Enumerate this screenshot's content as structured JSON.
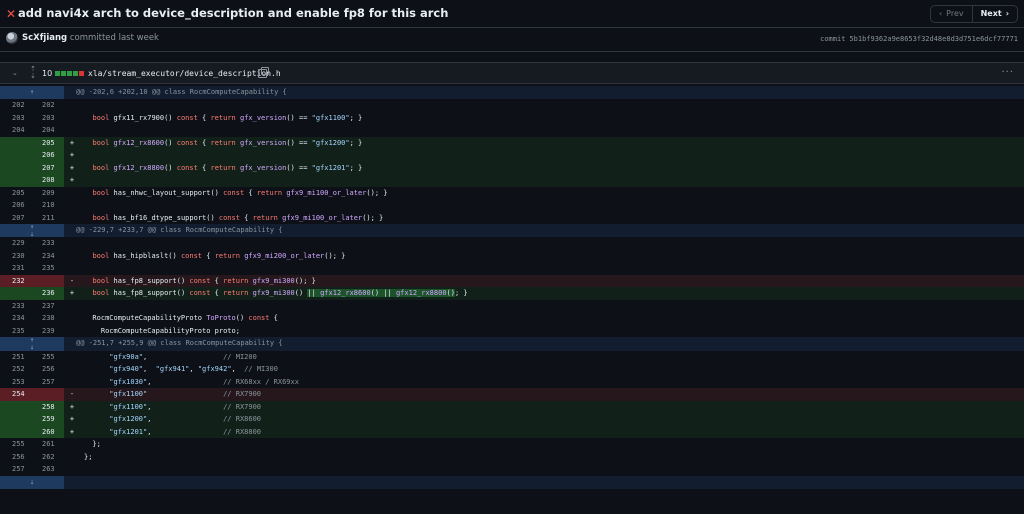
{
  "commit": {
    "title": "add navi4x arch to device_description and enable fp8 for this arch",
    "author": "ScXfjiang",
    "committed_text": "committed last week",
    "sha_label": "commit",
    "sha": "5b1bf9362a9e8653f32d48e8d3d751e6dcf77771",
    "prev_label": "Prev",
    "next_label": "Next"
  },
  "file": {
    "change_count": "10",
    "path": "xla/stream_executor/device_description.h",
    "diffstat_colors": [
      "#2ea043",
      "#2ea043",
      "#2ea043",
      "#2ea043",
      "#da3633"
    ]
  },
  "hunks": [
    {
      "header": "@@ -202,6 +202,10 @@ class RocmComputeCapability {"
    },
    {
      "header": "@@ -229,7 +233,7 @@ class RocmComputeCapability {"
    },
    {
      "header": "@@ -251,7 +255,9 @@ class RocmComputeCapability {"
    }
  ],
  "lines": [
    {
      "type": "ctx",
      "old": "202",
      "new": "202",
      "sign": "",
      "code": ""
    },
    {
      "type": "ctx",
      "old": "203",
      "new": "203",
      "sign": "",
      "code": "  bool gfx11_rx7900() const { return gfx_version() == \"gfx1100\"; }"
    },
    {
      "type": "ctx",
      "old": "204",
      "new": "204",
      "sign": "",
      "code": ""
    },
    {
      "type": "add",
      "old": "",
      "new": "205",
      "sign": "+",
      "code": "  bool gfx12_rx8600() const { return gfx_version() == \"gfx1200\"; }"
    },
    {
      "type": "add",
      "old": "",
      "new": "206",
      "sign": "+",
      "code": ""
    },
    {
      "type": "add",
      "old": "",
      "new": "207",
      "sign": "+",
      "code": "  bool gfx12_rx8800() const { return gfx_version() == \"gfx1201\"; }"
    },
    {
      "type": "add",
      "old": "",
      "new": "208",
      "sign": "+",
      "code": ""
    },
    {
      "type": "ctx",
      "old": "205",
      "new": "209",
      "sign": "",
      "code": "  bool has_nhwc_layout_support() const { return gfx9_mi100_or_later(); }"
    },
    {
      "type": "ctx",
      "old": "206",
      "new": "210",
      "sign": "",
      "code": ""
    },
    {
      "type": "ctx",
      "old": "207",
      "new": "211",
      "sign": "",
      "code": "  bool has_bf16_dtype_support() const { return gfx9_mi100_or_later(); }"
    },
    {
      "type": "ctx",
      "old": "229",
      "new": "233",
      "sign": "",
      "code": ""
    },
    {
      "type": "ctx",
      "old": "230",
      "new": "234",
      "sign": "",
      "code": "  bool has_hipblaslt() const { return gfx9_mi200_or_later(); }"
    },
    {
      "type": "ctx",
      "old": "231",
      "new": "235",
      "sign": "",
      "code": ""
    },
    {
      "type": "del",
      "old": "232",
      "new": "",
      "sign": "-",
      "code": "  bool has_fp8_support() const { return gfx9_mi300(); }"
    },
    {
      "type": "add",
      "old": "",
      "new": "236",
      "sign": "+",
      "code": "  bool has_fp8_support() const { return gfx9_mi300() || gfx12_rx8600() || gfx12_rx8800(); }"
    },
    {
      "type": "ctx",
      "old": "233",
      "new": "237",
      "sign": "",
      "code": ""
    },
    {
      "type": "ctx",
      "old": "234",
      "new": "238",
      "sign": "",
      "code": "  RocmComputeCapabilityProto ToProto() const {"
    },
    {
      "type": "ctx",
      "old": "235",
      "new": "239",
      "sign": "",
      "code": "    RocmComputeCapabilityProto proto;"
    },
    {
      "type": "ctx",
      "old": "251",
      "new": "255",
      "sign": "",
      "code": "      \"gfx90a\",                  // MI200"
    },
    {
      "type": "ctx",
      "old": "252",
      "new": "256",
      "sign": "",
      "code": "      \"gfx940\",  \"gfx941\", \"gfx942\",  // MI300"
    },
    {
      "type": "ctx",
      "old": "253",
      "new": "257",
      "sign": "",
      "code": "      \"gfx1030\",                 // RX68xx / RX69xx"
    },
    {
      "type": "del",
      "old": "254",
      "new": "",
      "sign": "-",
      "code": "      \"gfx1100\"                  // RX7900"
    },
    {
      "type": "add",
      "old": "",
      "new": "258",
      "sign": "+",
      "code": "      \"gfx1100\",                 // RX7900"
    },
    {
      "type": "add",
      "old": "",
      "new": "259",
      "sign": "+",
      "code": "      \"gfx1200\",                 // RX8600"
    },
    {
      "type": "add",
      "old": "",
      "new": "260",
      "sign": "+",
      "code": "      \"gfx1201\",                 // RX8800"
    },
    {
      "type": "ctx",
      "old": "255",
      "new": "261",
      "sign": "",
      "code": "  };"
    },
    {
      "type": "ctx",
      "old": "256",
      "new": "262",
      "sign": "",
      "code": "};"
    },
    {
      "type": "ctx",
      "old": "257",
      "new": "263",
      "sign": "",
      "code": ""
    }
  ]
}
